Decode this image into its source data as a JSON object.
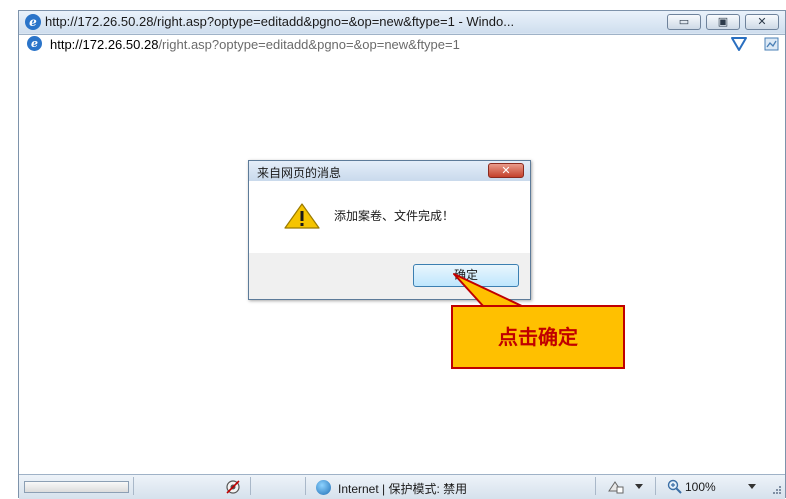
{
  "window": {
    "title": "http://172.26.50.28/right.asp?optype=editadd&pgno=&op=new&ftype=1 - Windo...",
    "minimize": "▭",
    "maximize": "▣",
    "close": "✕"
  },
  "address": {
    "host": "http://172.26.50.28",
    "rest": "/right.asp?optype=editadd&pgno=&op=new&ftype=1"
  },
  "dialog": {
    "title": "来自网页的消息",
    "close": "✕",
    "message": "添加案卷、文件完成！",
    "ok_label": "确定"
  },
  "callout": {
    "text": "点击确定"
  },
  "status": {
    "zone": "Internet | 保护模式: 禁用",
    "zoom": "100%"
  },
  "colors": {
    "callout_fill": "#ffc000",
    "callout_border": "#c00000",
    "callout_text": "#c00000"
  }
}
